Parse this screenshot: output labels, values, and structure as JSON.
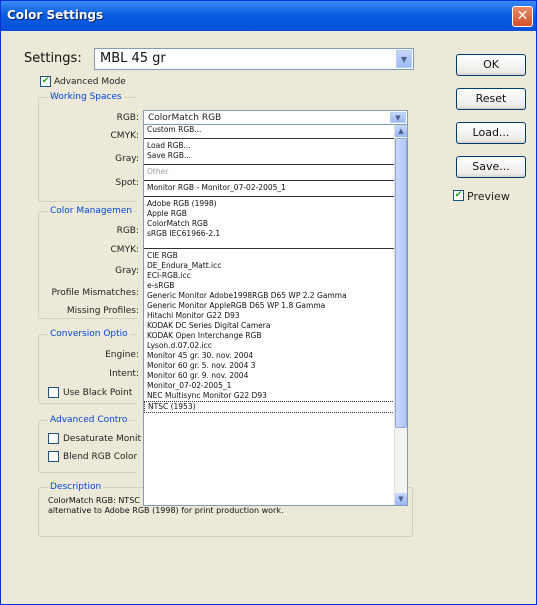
{
  "window": {
    "title": "Color Settings",
    "close_glyph": "✕"
  },
  "settings": {
    "label": "Settings:",
    "value": "MBL 45 gr"
  },
  "advanced_mode_label": "Advanced Mode",
  "buttons": {
    "ok": "OK",
    "reset": "Reset",
    "load": "Load...",
    "save": "Save..."
  },
  "preview_label": "Preview",
  "working_spaces": {
    "title": "Working Spaces",
    "rgb_label": "RGB:",
    "rgb_value": "ColorMatch RGB",
    "cmyk_label": "CMYK:",
    "gray_label": "Gray:",
    "spot_label": "Spot:"
  },
  "color_management": {
    "title": "Color Managemen",
    "rgb_label": "RGB:",
    "cmyk_label": "CMYK:",
    "gray_label": "Gray:",
    "profile_mismatches_label": "Profile Mismatches:",
    "missing_profiles_label": "Missing Profiles:"
  },
  "conversion_options": {
    "title": "Conversion Optio",
    "engine_label": "Engine:",
    "intent_label": "Intent:",
    "black_point_label": "Use Black Point"
  },
  "advanced_controls": {
    "title": "Advanced Contro",
    "desaturate_label": "Desaturate Monit",
    "blend_label": "Blend RGB Color"
  },
  "description": {
    "title": "Description",
    "text": "ColorMatch RGB: NTSC (1953) monitors. This space provides a smaller gamut alternative to Adobe RGB (1998) for print production work."
  },
  "rgb_dropdown_items": [
    {
      "type": "item",
      "label": "Custom RGB..."
    },
    {
      "type": "sep"
    },
    {
      "type": "item",
      "label": "Load RGB..."
    },
    {
      "type": "item",
      "label": "Save RGB..."
    },
    {
      "type": "sep"
    },
    {
      "type": "disabled",
      "label": "Other"
    },
    {
      "type": "sep"
    },
    {
      "type": "item",
      "label": "Monitor RGB - Monitor_07-02-2005_1"
    },
    {
      "type": "sep"
    },
    {
      "type": "item",
      "label": "Adobe RGB (1998)"
    },
    {
      "type": "item",
      "label": "Apple RGB"
    },
    {
      "type": "item",
      "label": "ColorMatch RGB"
    },
    {
      "type": "item",
      "label": "sRGB IEC61966-2.1"
    },
    {
      "type": "gap"
    },
    {
      "type": "sep"
    },
    {
      "type": "item",
      "label": "CIE RGB"
    },
    {
      "type": "item",
      "label": "DE_Endura_Matt.icc"
    },
    {
      "type": "item",
      "label": "ECI-RGB.icc"
    },
    {
      "type": "item",
      "label": "e-sRGB"
    },
    {
      "type": "item",
      "label": "Generic Monitor Adobe1998RGB D65 WP 2.2 Gamma"
    },
    {
      "type": "item",
      "label": "Generic Monitor AppleRGB D65 WP 1.8 Gamma"
    },
    {
      "type": "item",
      "label": "Hitachi Monitor G22 D93"
    },
    {
      "type": "item",
      "label": "KODAK DC Series Digital Camera"
    },
    {
      "type": "item",
      "label": "KODAK Open Interchange RGB"
    },
    {
      "type": "item",
      "label": "Lyson.d.07.02.icc"
    },
    {
      "type": "item",
      "label": "Monitor 45 gr. 30. nov. 2004"
    },
    {
      "type": "item",
      "label": "Monitor 60 gr. 5. nov. 2004 3"
    },
    {
      "type": "item",
      "label": "Monitor 60 gr. 9. nov. 2004"
    },
    {
      "type": "item",
      "label": "Monitor_07-02-2005_1"
    },
    {
      "type": "item",
      "label": "NEC Multisync Monitor G22 D93"
    },
    {
      "type": "selected",
      "label": "NTSC (1953)"
    }
  ],
  "colors": {
    "title_bar": "#0a5de0",
    "dialog_bg": "#ece9d8",
    "group_title": "#0046d5",
    "check": "#21a121"
  },
  "icons": {
    "close": "close-icon",
    "dropdown": "chevron-down-icon",
    "check": "checkmark-icon"
  }
}
